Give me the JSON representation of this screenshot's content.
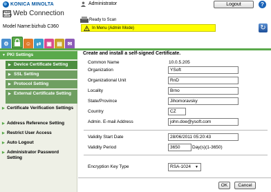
{
  "header": {
    "brand": "KONICA MINOLTA",
    "pagescope_mark": "PAGE SCOPE",
    "product": "Web Connection",
    "model_label": "Model Name:bizhub C360",
    "user_label": "Administrator",
    "logout_label": "Logout",
    "status_ready": "Ready to Scan",
    "status_warning": "In Menu (Admin Mode)"
  },
  "tabs": [
    {
      "icon": "maintenance-icon",
      "color": "#4a8fcf"
    },
    {
      "icon": "security-lock-icon",
      "color": "#5aa94b",
      "active": true
    },
    {
      "icon": "user-auth-icon",
      "color": "#e07a2a"
    },
    {
      "icon": "network-icon",
      "color": "#3b9ccb"
    },
    {
      "icon": "box-icon",
      "color": "#d94b8f"
    },
    {
      "icon": "print-settings-icon",
      "color": "#c9a227"
    },
    {
      "icon": "store-address-icon",
      "color": "#8d5bb8"
    }
  ],
  "sidebar": {
    "items": [
      {
        "label": "PKI Settings"
      },
      {
        "label": "Device Certificate Setting"
      },
      {
        "label": "SSL Setting"
      },
      {
        "label": "Protocol Setting"
      },
      {
        "label": "External Certificate Setting"
      },
      {
        "label": "Certificate Verification Settings"
      },
      {
        "label": "Address Reference Setting"
      },
      {
        "label": "Restrict User Access"
      },
      {
        "label": "Auto Logout"
      },
      {
        "label": "Administrator Password Setting"
      }
    ]
  },
  "form": {
    "title": "Create and install a self-signed Certificate.",
    "common_name_label": "Common Name",
    "common_name_value": "10.0.5.205",
    "organization_label": "Organization",
    "organization_value": "YSoft",
    "org_unit_label": "Organizational Unit",
    "org_unit_value": "RnD",
    "locality_label": "Locality",
    "locality_value": "Brno",
    "state_label": "State/Province",
    "state_value": "Jihomoravsky",
    "country_label": "Country",
    "country_value": "CZ",
    "email_label": "Admin. E-mail Address",
    "email_value": "john.doe@ysoft.com",
    "validity_start_label": "Validity Start Date",
    "validity_start_value": "28/06/2011 05:20:43",
    "validity_period_label": "Validity Period",
    "validity_period_value": "3650",
    "validity_period_unit": "Day(s)(1-3650)",
    "encryption_label": "Encryption Key Type",
    "encryption_value": "RSA-1024"
  },
  "footer": {
    "ok_label": "OK",
    "cancel_label": "Cancel"
  },
  "colors": {
    "accent_green": "#5aa94b",
    "warning_yellow": "#ffff00",
    "brand_blue": "#00549f"
  }
}
